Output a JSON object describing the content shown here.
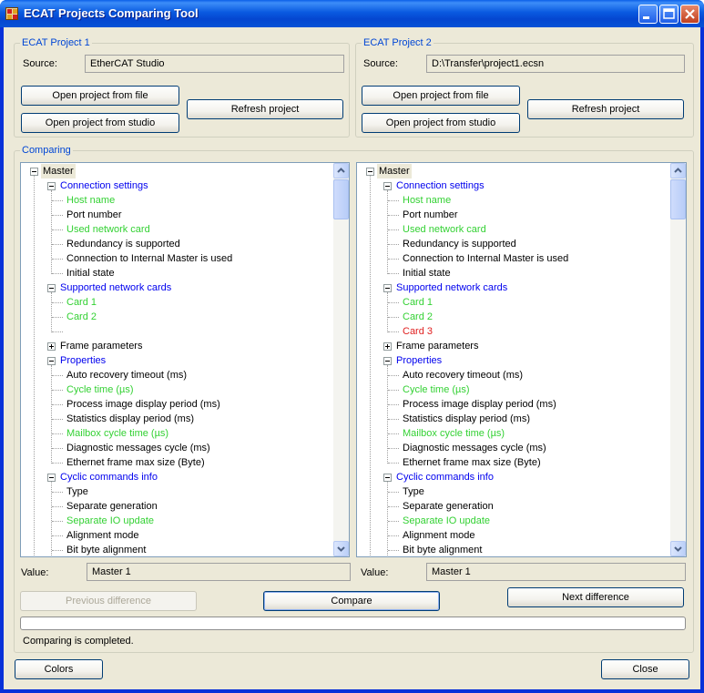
{
  "window": {
    "title": "ECAT Projects Comparing Tool"
  },
  "project1": {
    "group_title": "ECAT Project 1",
    "source_label": "Source:",
    "source_value": "EtherCAT Studio",
    "open_file_label": "Open project from file",
    "open_studio_label": "Open project from studio",
    "refresh_label": "Refresh project"
  },
  "project2": {
    "group_title": "ECAT Project 2",
    "source_label": "Source:",
    "source_value": "D:\\Transfer\\project1.ecsn",
    "open_file_label": "Open project from file",
    "open_studio_label": "Open project from studio",
    "refresh_label": "Refresh project"
  },
  "comparing": {
    "group_title": "Comparing",
    "colors": {
      "blue": "#0000ee",
      "green": "#33d133",
      "red": "#e02020",
      "black": "#000000"
    },
    "left_tree": [
      {
        "text": "Master",
        "color": "black",
        "expander": "minus",
        "selected": true
      },
      {
        "text": "Connection settings",
        "color": "blue",
        "expander": "minus"
      },
      {
        "text": "Host name",
        "color": "green"
      },
      {
        "text": "Port number",
        "color": "black"
      },
      {
        "text": "Used network card",
        "color": "green"
      },
      {
        "text": "Redundancy is supported",
        "color": "black"
      },
      {
        "text": "Connection to Internal Master is used",
        "color": "black"
      },
      {
        "text": "Initial state",
        "color": "black"
      },
      {
        "text": "Supported network cards",
        "color": "blue",
        "expander": "minus"
      },
      {
        "text": "Card 1",
        "color": "green"
      },
      {
        "text": "Card 2",
        "color": "green"
      },
      {
        "text": "",
        "color": "black"
      },
      {
        "text": "Frame parameters",
        "color": "black",
        "expander": "plus"
      },
      {
        "text": "Properties",
        "color": "blue",
        "expander": "minus"
      },
      {
        "text": "Auto recovery timeout (ms)",
        "color": "black"
      },
      {
        "text": "Cycle time (µs)",
        "color": "green"
      },
      {
        "text": "Process image display period (ms)",
        "color": "black"
      },
      {
        "text": "Statistics display period (ms)",
        "color": "black"
      },
      {
        "text": "Mailbox cycle time (µs)",
        "color": "green"
      },
      {
        "text": "Diagnostic messages cycle (ms)",
        "color": "black"
      },
      {
        "text": "Ethernet frame max size (Byte)",
        "color": "black"
      },
      {
        "text": "Cyclic commands info",
        "color": "blue",
        "expander": "minus"
      },
      {
        "text": "Type",
        "color": "black"
      },
      {
        "text": "Separate generation",
        "color": "black"
      },
      {
        "text": "Separate IO update",
        "color": "green"
      },
      {
        "text": "Alignment mode",
        "color": "black"
      },
      {
        "text": "Bit byte alignment",
        "color": "black"
      }
    ],
    "right_tree": [
      {
        "text": "Master",
        "color": "black",
        "expander": "minus",
        "selected": true
      },
      {
        "text": "Connection settings",
        "color": "blue",
        "expander": "minus"
      },
      {
        "text": "Host name",
        "color": "green"
      },
      {
        "text": "Port number",
        "color": "black"
      },
      {
        "text": "Used network card",
        "color": "green"
      },
      {
        "text": "Redundancy is supported",
        "color": "black"
      },
      {
        "text": "Connection to Internal Master is used",
        "color": "black"
      },
      {
        "text": "Initial state",
        "color": "black"
      },
      {
        "text": "Supported network cards",
        "color": "blue",
        "expander": "minus"
      },
      {
        "text": "Card 1",
        "color": "green"
      },
      {
        "text": "Card 2",
        "color": "green"
      },
      {
        "text": "Card 3",
        "color": "red"
      },
      {
        "text": "Frame parameters",
        "color": "black",
        "expander": "plus"
      },
      {
        "text": "Properties",
        "color": "blue",
        "expander": "minus"
      },
      {
        "text": "Auto recovery timeout (ms)",
        "color": "black"
      },
      {
        "text": "Cycle time (µs)",
        "color": "green"
      },
      {
        "text": "Process image display period (ms)",
        "color": "black"
      },
      {
        "text": "Statistics display period (ms)",
        "color": "black"
      },
      {
        "text": "Mailbox cycle time (µs)",
        "color": "green"
      },
      {
        "text": "Diagnostic messages cycle (ms)",
        "color": "black"
      },
      {
        "text": "Ethernet frame max size (Byte)",
        "color": "black"
      },
      {
        "text": "Cyclic commands info",
        "color": "blue",
        "expander": "minus"
      },
      {
        "text": "Type",
        "color": "black"
      },
      {
        "text": "Separate generation",
        "color": "black"
      },
      {
        "text": "Separate IO update",
        "color": "green"
      },
      {
        "text": "Alignment mode",
        "color": "black"
      },
      {
        "text": "Bit byte alignment",
        "color": "black"
      }
    ],
    "left_value_label": "Value:",
    "left_value": "Master 1",
    "right_value_label": "Value:",
    "right_value": "Master 1",
    "prev_label": "Previous difference",
    "compare_label": "Compare",
    "next_label": "Next difference",
    "progress": 0,
    "status": "Comparing is completed."
  },
  "footer": {
    "colors_label": "Colors",
    "close_label": "Close"
  }
}
